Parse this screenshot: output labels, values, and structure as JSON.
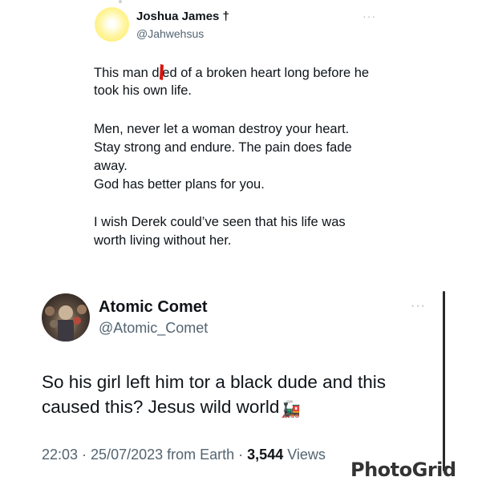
{
  "tweet1": {
    "author_name": "Joshua James †",
    "author_handle": "@Jahwehsus",
    "more_label": "···",
    "lines": [
      "This man died of a broken heart long before he",
      "took his own life.",
      "",
      "Men, never let a woman destroy your heart.",
      "Stay strong and endure. The pain does fade",
      "away.",
      "God has better plans for you.",
      "",
      "I wish Derek could’ve seen that his life was",
      "worth living without her."
    ]
  },
  "tweet2": {
    "author_name": "Atomic Comet",
    "author_handle": "@Atomic_Comet",
    "more_label": "···",
    "lines": [
      "So his girl left him tor a black dude and this",
      "caused this? Jesus wild world"
    ],
    "emoji": "🚂",
    "emoji_name": "train-icon",
    "meta": {
      "time": "22:03",
      "separator": " · ",
      "date": "25/07/2023",
      "source": " from Earth",
      "views_count": "3,544",
      "views_label": " Views"
    }
  },
  "watermark": "PhotoGrid",
  "colors": {
    "text_primary": "#0f1419",
    "text_secondary": "#536471",
    "annotation_red": "#d9150f"
  }
}
